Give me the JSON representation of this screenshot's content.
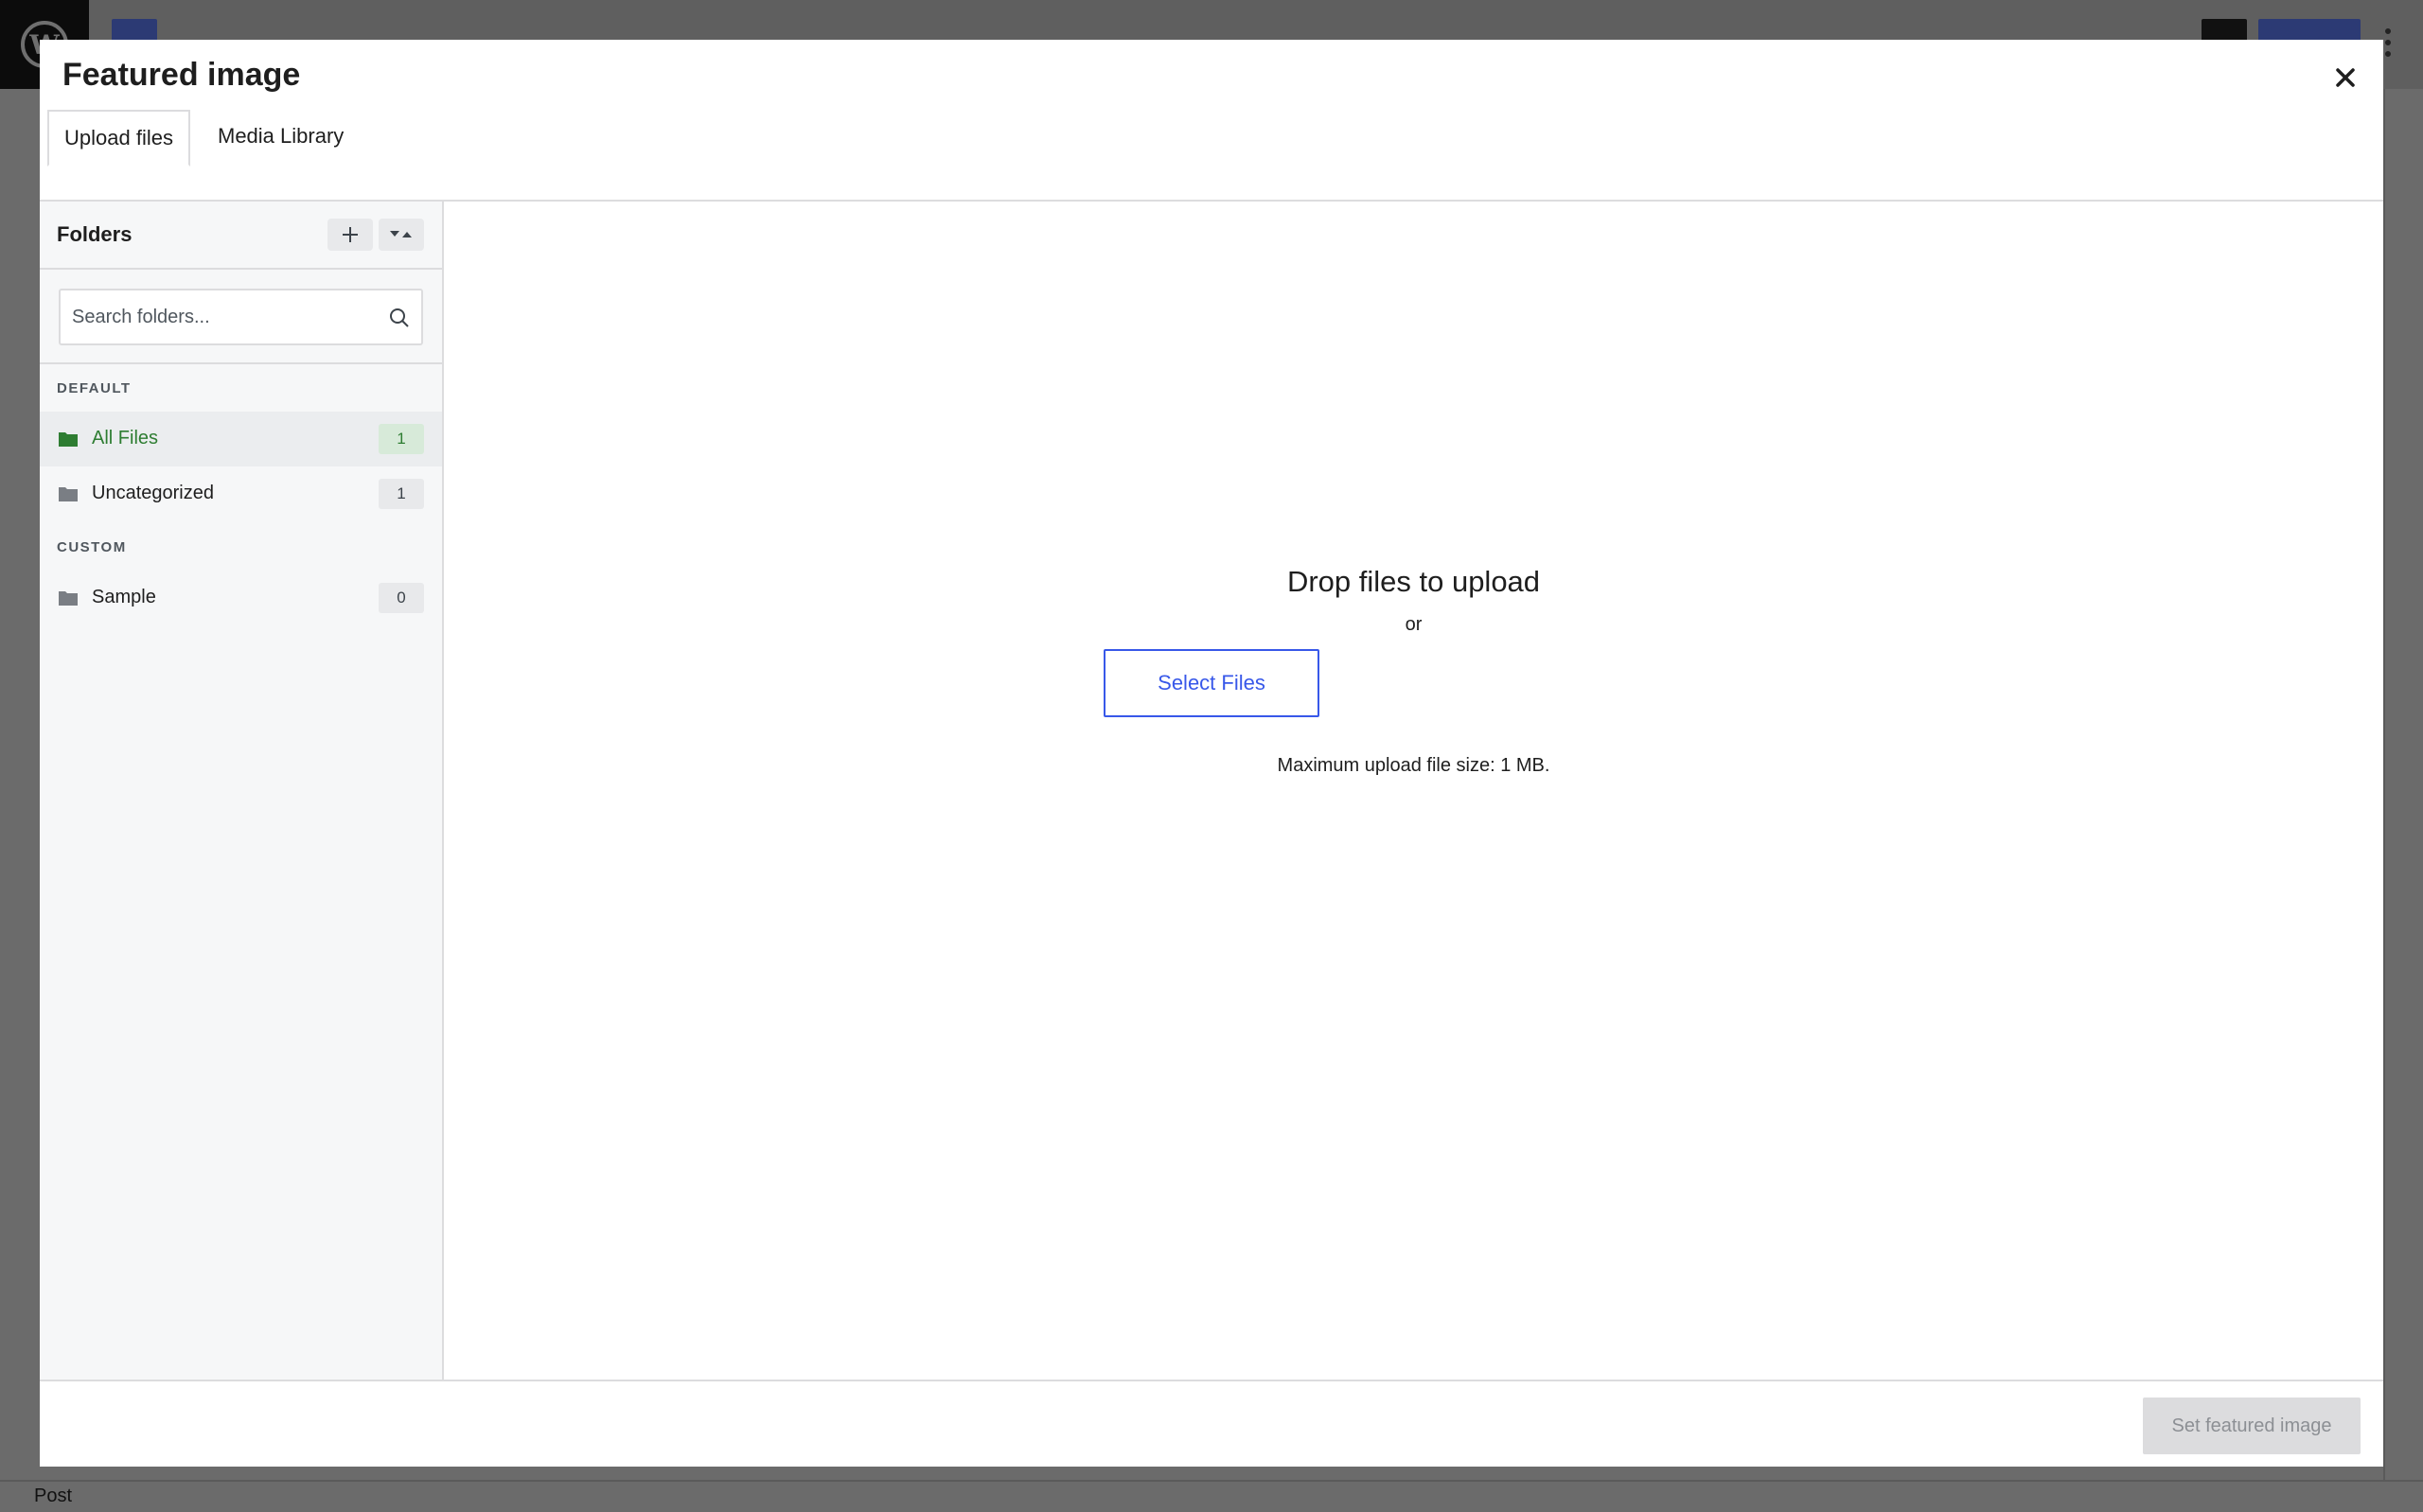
{
  "background": {
    "footer_label": "Post"
  },
  "modal": {
    "title": "Featured image",
    "close_icon": "close-icon",
    "tabs": [
      {
        "label": "Upload files",
        "active": true
      },
      {
        "label": "Media Library",
        "active": false
      }
    ]
  },
  "folders": {
    "title": "Folders",
    "add_icon": "plus-icon",
    "sort_icon": "sort-icon",
    "search": {
      "placeholder": "Search folders..."
    },
    "sections": [
      {
        "label": "DEFAULT",
        "items": [
          {
            "name": "All Files",
            "count": "1",
            "active": true
          },
          {
            "name": "Uncategorized",
            "count": "1",
            "active": false
          }
        ]
      },
      {
        "label": "CUSTOM",
        "items": [
          {
            "name": "Sample",
            "count": "0",
            "active": false
          }
        ]
      }
    ]
  },
  "upload": {
    "title": "Drop files to upload",
    "or": "or",
    "select_label": "Select Files",
    "max_size": "Maximum upload file size: 1 MB."
  },
  "footer": {
    "set_label": "Set featured image"
  },
  "colors": {
    "accent": "#3858e9",
    "active_folder": "#2e7d32",
    "overlay": "#6b6b6b"
  }
}
